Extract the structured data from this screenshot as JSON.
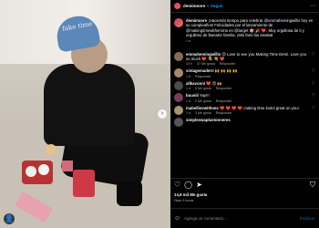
{
  "post": {
    "cap_text": "fake time",
    "user_badge": "👤"
  },
  "header": {
    "username": "demimoore",
    "separator": "•",
    "follow_label": "Seguir",
    "more_icon": "more-dots-icon"
  },
  "caption": {
    "username": "demimoore",
    "text_pre": "¡Haciendo tiempo para celebrar",
    "mention1": "@emmahemingwillis",
    "text_mid": "hoy en su cumpleaños! Felicidades por el lanzamiento de",
    "mention2": "@makingtimewithemma",
    "text_mid2": "en",
    "mention3": "@target",
    "text_end": "🎯 🎉 ❤️. Muy orgullosa de ti y orgulloso de llamarte familia. ¡Mis fans las amabal",
    "time": "1 d"
  },
  "comments": [
    {
      "username": "emmahemingwillis",
      "text": "😍 Love to see you Making Time Demi. Love you so much ❤️ 💐 💐 ❤️",
      "time": "14 h",
      "likes": "47 Me gusta",
      "reply": "Responder",
      "avatar_color": "#8a6a55"
    },
    {
      "username": "vintagemadern",
      "text": "🙌 🙌 🙌 🙌",
      "time": "1 d",
      "likes": "",
      "reply": "Responder",
      "avatar_color": "#aa8866"
    },
    {
      "username": "allkavonni",
      "text": "❤️ 😍 🙌",
      "time": "1 d",
      "likes": "5 Me gusta",
      "reply": "Responder",
      "avatar_color": "#4b4b4b"
    },
    {
      "username": "buusiii",
      "text": "Yay!!!",
      "time": "1 d",
      "likes": "2 Me gusta",
      "reply": "Responder",
      "avatar_color": "#7a3b5d"
    },
    {
      "username": "mabellinewithnes",
      "text": "❤️ ❤️ ❤️ ❤️ making time looks great on you!",
      "time": "1 d",
      "likes": "3 Me gusta",
      "reply": "Responder",
      "avatar_color": "#a89473"
    },
    {
      "username": "simpleswaplustonneres",
      "text": "",
      "time": "",
      "likes": "",
      "reply": "",
      "avatar_color": "#555555"
    }
  ],
  "actions": {
    "like_icon": "heart-icon",
    "comment_icon": "comment-icon",
    "share_icon": "send-icon",
    "save_icon": "bookmark-icon",
    "likes_count": "14,6 mil Me gusta",
    "time": "Hace 9 horas"
  },
  "add_comment": {
    "placeholder": "Agrega un comentario...",
    "publish_label": "Publicar"
  }
}
